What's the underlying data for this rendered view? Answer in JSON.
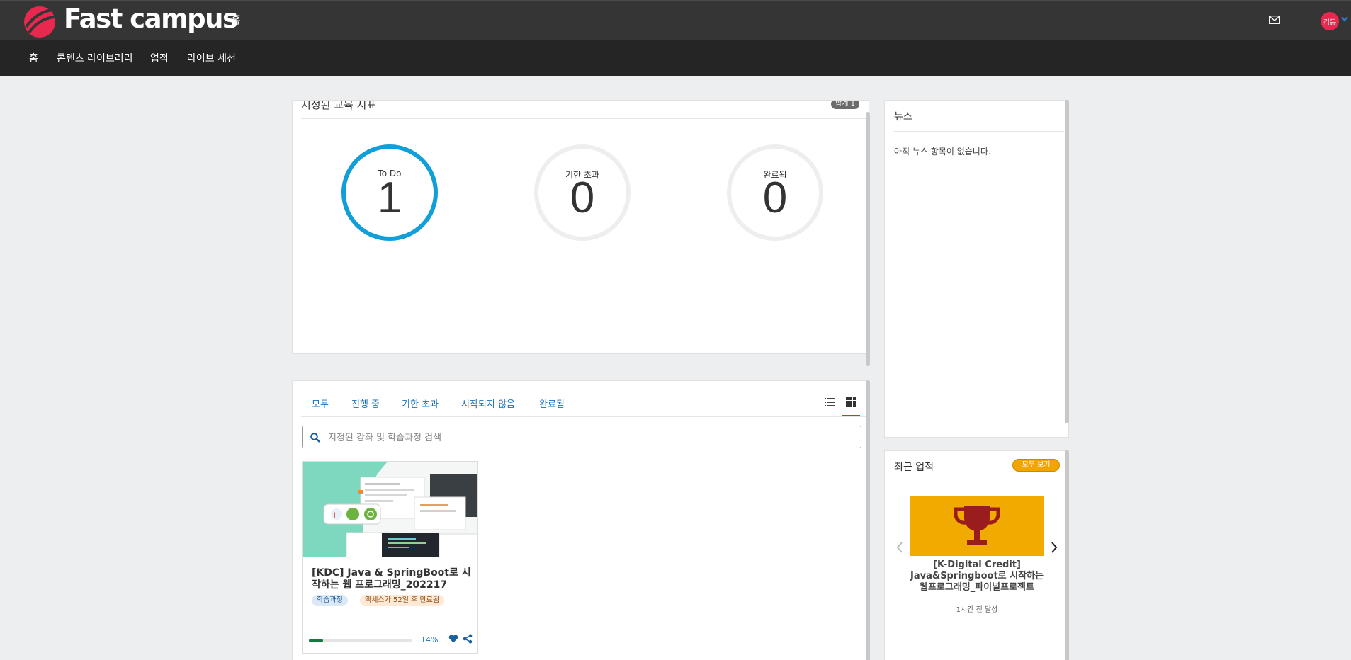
{
  "header": {
    "logo_text": "Fast campus",
    "page_label": "홈",
    "avatar_text": "김동",
    "icons": {
      "mail": "mail-icon",
      "chevron": "chevron-down-icon"
    }
  },
  "nav": {
    "items": [
      {
        "label": "홈"
      },
      {
        "label": "콘텐츠 라이브러리"
      },
      {
        "label": "업적"
      },
      {
        "label": "라이브 세션"
      }
    ]
  },
  "stats": {
    "title": "지정된 교육 지표",
    "badge": "합계 1",
    "items": [
      {
        "label": "To Do",
        "value": "1"
      },
      {
        "label": "기한 초과",
        "value": "0"
      },
      {
        "label": "완료됨",
        "value": "0"
      }
    ],
    "active_color": "#109fd8"
  },
  "courses": {
    "tabs": [
      {
        "label": "모두"
      },
      {
        "label": "진행 중"
      },
      {
        "label": "기한 초과"
      },
      {
        "label": "시작되지 않음"
      },
      {
        "label": "완료됨"
      }
    ],
    "search_placeholder": "지정된 강좌 및 학습과정 검색",
    "cards": [
      {
        "title": "[KDC] Java & SpringBoot로 시작하는 웹 프로그래밍_202217",
        "type_badge": "학습과정",
        "expire_badge": "액세스가 52일 후 만료됨",
        "progress": 14,
        "progress_label": "14%"
      }
    ]
  },
  "news": {
    "title": "뉴스",
    "empty_text": "아직 뉴스 항목이 없습니다."
  },
  "achievements": {
    "title": "최근 업적",
    "view_all": "모두 보기",
    "items": [
      {
        "title": "[K-Digital Credit] Java&Springboot로 시작하는 웹프로그래밍_파이널프로젝트",
        "time": "1시간 전 달성",
        "icon": "trophy-icon"
      }
    ],
    "accent": "#f0aa00"
  },
  "colors": {
    "brand": "#e8284f",
    "topbar": "#353535",
    "navbar": "#252525",
    "link": "#1a6fb5",
    "progress": "#127a3c"
  }
}
